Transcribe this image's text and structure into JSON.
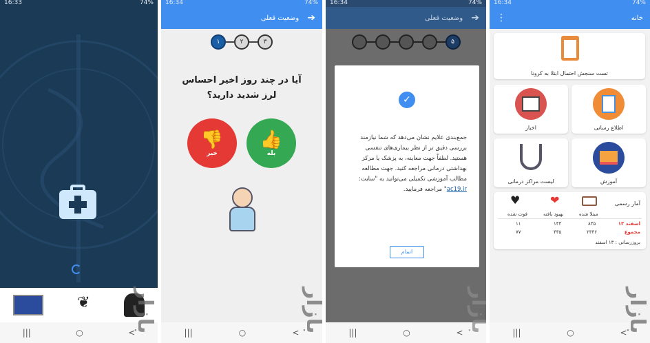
{
  "colors": {
    "brand": "#3f8ef0",
    "splash": "#1b3a55",
    "yes": "#34a853",
    "no": "#e53935",
    "accent": "#3f8ef0"
  },
  "p1": {
    "status_time": "16:33",
    "status_right": "74%",
    "spinner_icon": "spinner-icon"
  },
  "p2": {
    "status_time": "16:34",
    "status_right": "74%",
    "title": "وضعیت فعلی",
    "steps": [
      "۱",
      "۲",
      "۳"
    ],
    "question": "آیا در چند روز اخیر احساس لرز شدید دارید؟",
    "yes": "بله",
    "no": "خیر"
  },
  "p3": {
    "status_time": "16:34",
    "status_right": "74%",
    "title": "وضعیت فعلی",
    "last_step": "۵",
    "dialog_text_1": "جمع‌بندی علایم نشان می‌دهد که شما نیازمند بررسی دقیق تر از نظر بیماری‌های تنفسی هستید.",
    "dialog_text_2": "لطفاً جهت معاینه، به پزشک یا مرکز بهداشتی درمانی مراجعه کنید.",
    "dialog_text_3a": "جهت مطالعه مطالب آموزشی تکمیلی می‌توانید به \"سایت:",
    "dialog_link": "ac19.ir",
    "dialog_text_3b": "\" مراجعه فرمایید.",
    "finish": "اتمام"
  },
  "p4": {
    "status_time": "16:34",
    "status_right": "74%",
    "title": "خانه",
    "test_card": "تست سنجش احتمال ابتلا به کرونا",
    "news": "اخبار",
    "info": "اطلاع رسانی",
    "centers": "لیست مراکز درمانی",
    "edu": "آموزش",
    "stats": {
      "heading": "آمار رسمی",
      "cols": [
        "مبتلا شده",
        "بهبود یافته",
        "فوت شده"
      ],
      "row1_label": "۱۳ اسفند",
      "row1": [
        "۸۳۵",
        "۱۴۴",
        "۱۱"
      ],
      "row2_label": "مجموع",
      "row2": [
        "۲۳۳۶",
        "۴۳۵",
        "۷۷"
      ],
      "updated": "بروزرسانی : ۱۳ اسفند"
    }
  },
  "nav": {
    "recent": "|||",
    "home": "○",
    "back": "<"
  }
}
